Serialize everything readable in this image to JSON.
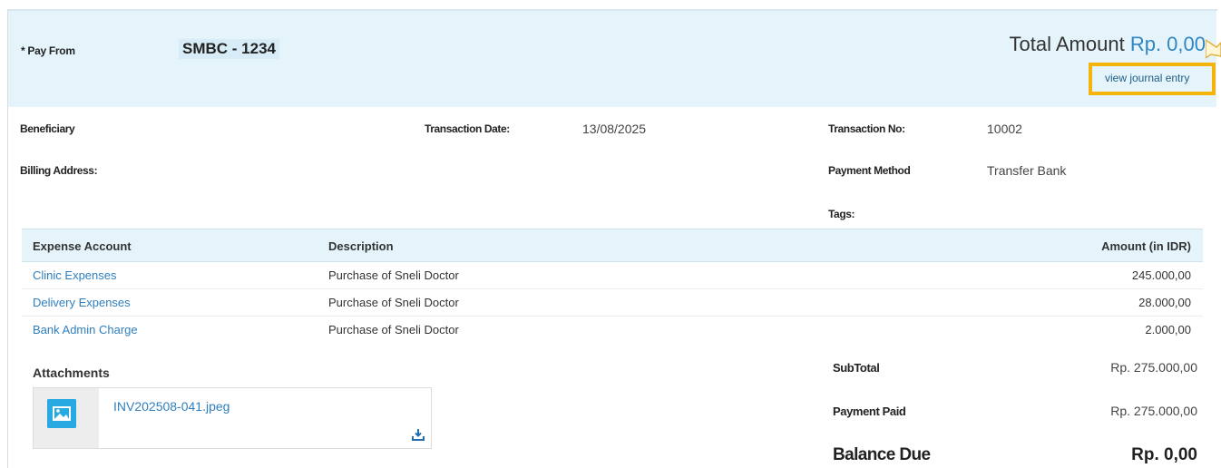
{
  "header": {
    "pay_from_label": "* Pay From",
    "pay_from_value": "SMBC - 1234",
    "total_label": "Total Amount ",
    "total_value": "Rp. 0,00",
    "journal_link": "view journal entry"
  },
  "details": {
    "beneficiary_label": "Beneficiary",
    "billing_address_label": "Billing Address:",
    "transaction_date_label": "Transaction Date:",
    "transaction_date_value": "13/08/2025",
    "transaction_no_label": "Transaction No:",
    "transaction_no_value": "10002",
    "payment_method_label": "Payment Method",
    "payment_method_value": "Transfer Bank",
    "tags_label": "Tags:"
  },
  "table": {
    "columns": [
      "Expense Account",
      "Description",
      "Amount (in IDR)"
    ],
    "rows": [
      {
        "account": "Clinic Expenses",
        "description": "Purchase of Sneli Doctor",
        "amount": "245.000,00"
      },
      {
        "account": "Delivery Expenses",
        "description": "Purchase of Sneli Doctor",
        "amount": "28.000,00"
      },
      {
        "account": "Bank Admin Charge",
        "description": "Purchase of Sneli Doctor",
        "amount": "2.000,00"
      }
    ]
  },
  "attachments": {
    "title": "Attachments",
    "files": [
      {
        "name": "INV202508-041.jpeg"
      }
    ]
  },
  "summary": {
    "subtotal_label": "SubTotal",
    "subtotal_value": "Rp. 275.000,00",
    "payment_paid_label": "Payment Paid",
    "payment_paid_value": "Rp. 275.000,00",
    "balance_due_label": "Balance Due",
    "balance_due_value": "Rp. 0,00"
  },
  "colors": {
    "header_bg": "#e5f4fb",
    "link": "#2f7fbf",
    "highlight": "#f5b40a"
  },
  "icons": [
    "cursor-icon",
    "image-icon",
    "download-icon"
  ]
}
